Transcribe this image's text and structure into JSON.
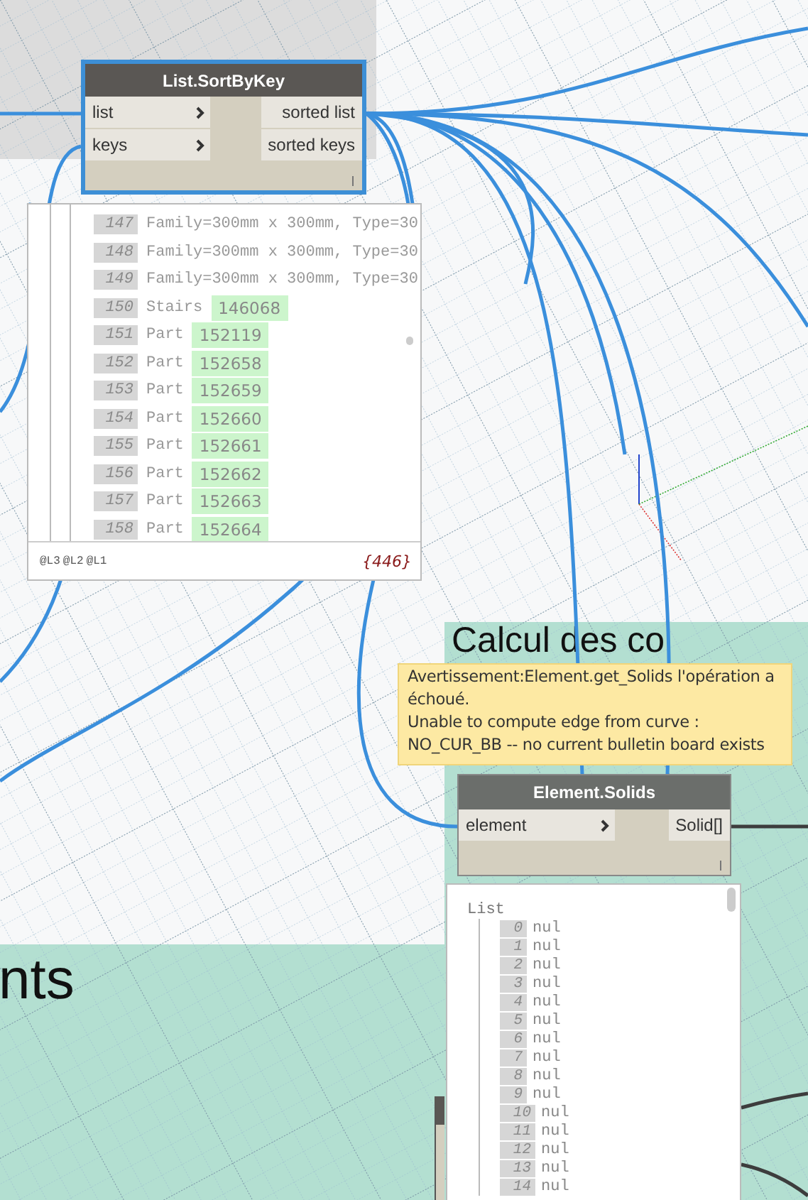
{
  "groups": [
    {
      "title": "Calcul des co"
    },
    {
      "title": "nts"
    }
  ],
  "nodes": [
    {
      "title": "List.SortByKey",
      "selected": true,
      "inputs": [
        "list",
        "keys"
      ],
      "outputs": [
        "sorted list",
        "sorted keys"
      ]
    },
    {
      "title": "Element.Solids",
      "selected": false,
      "inputs": [
        "element"
      ],
      "outputs": [
        "Solid[]"
      ]
    }
  ],
  "sort_preview": {
    "rows": [
      {
        "index": "147",
        "text": "Family=300mm x 300mm, Type=30"
      },
      {
        "index": "148",
        "text": "Family=300mm x 300mm, Type=30"
      },
      {
        "index": "149",
        "text": "Family=300mm x 300mm, Type=30"
      },
      {
        "index": "150",
        "text": "Stairs",
        "tag": "146068"
      },
      {
        "index": "151",
        "text": "Part",
        "tag": "152119"
      },
      {
        "index": "152",
        "text": "Part",
        "tag": "152658"
      },
      {
        "index": "153",
        "text": "Part",
        "tag": "152659"
      },
      {
        "index": "154",
        "text": "Part",
        "tag": "152660"
      },
      {
        "index": "155",
        "text": "Part",
        "tag": "152661"
      },
      {
        "index": "156",
        "text": "Part",
        "tag": "152662"
      },
      {
        "index": "157",
        "text": "Part",
        "tag": "152663"
      },
      {
        "index": "158",
        "text": "Part",
        "tag": "152664"
      }
    ],
    "levels": [
      "@L3",
      "@L2",
      "@L1"
    ],
    "count": "{446}"
  },
  "tooltip": {
    "paragraphs": [
      "Avertissement:Element.get_Solids l'opération a échoué.",
      "Unable to compute edge from curve : NO_CUR_BB -- no current bulletin board exists"
    ]
  },
  "solids_preview": {
    "header": "List",
    "rows": [
      {
        "index": "0",
        "value": "nul"
      },
      {
        "index": "1",
        "value": "nul"
      },
      {
        "index": "2",
        "value": "nul"
      },
      {
        "index": "3",
        "value": "nul"
      },
      {
        "index": "4",
        "value": "nul"
      },
      {
        "index": "5",
        "value": "nul"
      },
      {
        "index": "6",
        "value": "nul"
      },
      {
        "index": "7",
        "value": "nul"
      },
      {
        "index": "8",
        "value": "nul"
      },
      {
        "index": "9",
        "value": "nul"
      },
      {
        "index": "10",
        "value": "nul"
      },
      {
        "index": "11",
        "value": "nul"
      },
      {
        "index": "12",
        "value": "nul"
      },
      {
        "index": "13",
        "value": "nul"
      },
      {
        "index": "14",
        "value": "nul"
      }
    ]
  }
}
